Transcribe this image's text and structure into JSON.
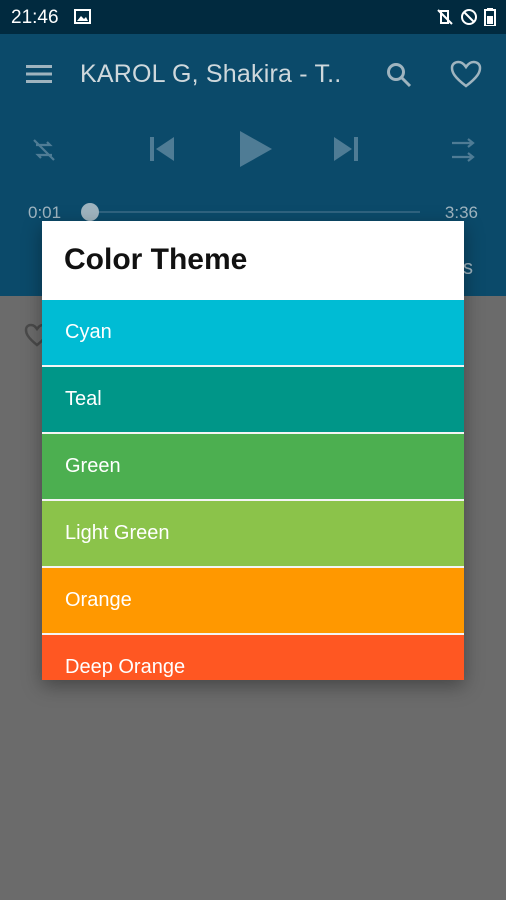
{
  "status_bar": {
    "time": "21:46",
    "icons": [
      "image-icon",
      "mute-vibrate-icon",
      "do-not-disturb-icon",
      "battery-icon"
    ]
  },
  "player": {
    "song_title": "KAROL G, Shakira - T..",
    "current_time": "0:01",
    "total_time": "3:36",
    "progress": 0.005,
    "side_text": "s"
  },
  "dialog": {
    "title": "Color Theme",
    "themes": [
      {
        "label": "Cyan",
        "color": "#00bcd4"
      },
      {
        "label": "Teal",
        "color": "#009688"
      },
      {
        "label": "Green",
        "color": "#4caf50"
      },
      {
        "label": "Light Green",
        "color": "#8bc34a"
      },
      {
        "label": "Orange",
        "color": "#ff9800"
      },
      {
        "label": "Deep Orange",
        "color": "#ff5722"
      }
    ]
  },
  "colors": {
    "status_bar": "#012a3f",
    "app_bar": "#0b4a6a",
    "overlay": "#6b6b6b"
  }
}
